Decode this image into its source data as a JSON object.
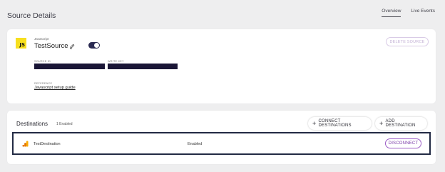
{
  "header": {
    "title": "Source Details",
    "tabs": [
      {
        "label": "Overview",
        "active": true
      },
      {
        "label": "Live Events",
        "active": false
      }
    ]
  },
  "source": {
    "logo_text": "JS",
    "type": "Javascript",
    "name": "TestSource",
    "enabled": true,
    "delete_label": "DELETE SOURCE",
    "source_id_label": "SOURCE ID",
    "write_key_label": "WRITE KEY",
    "reference_label": "REFERENCE",
    "reference_link": "Javascript setup guide"
  },
  "destinations": {
    "title": "Destinations",
    "count_label": "1 Enabled",
    "connect_label": "CONNECT DESTINATIONS",
    "add_label": "ADD DESTINATION",
    "rows": [
      {
        "name": "TestDestination",
        "status": "Enabled",
        "action_label": "DISCONNECT"
      }
    ]
  },
  "colors": {
    "accent": "#7a3aa8",
    "toggle": "#2a2a52",
    "redaction": "#1a1636",
    "js_logo": "#f7df1e",
    "analytics_icon": "#f9ab00"
  },
  "icons": {
    "edit": "pencil-icon",
    "plus": "plus-icon",
    "destination": "google-analytics-icon"
  }
}
